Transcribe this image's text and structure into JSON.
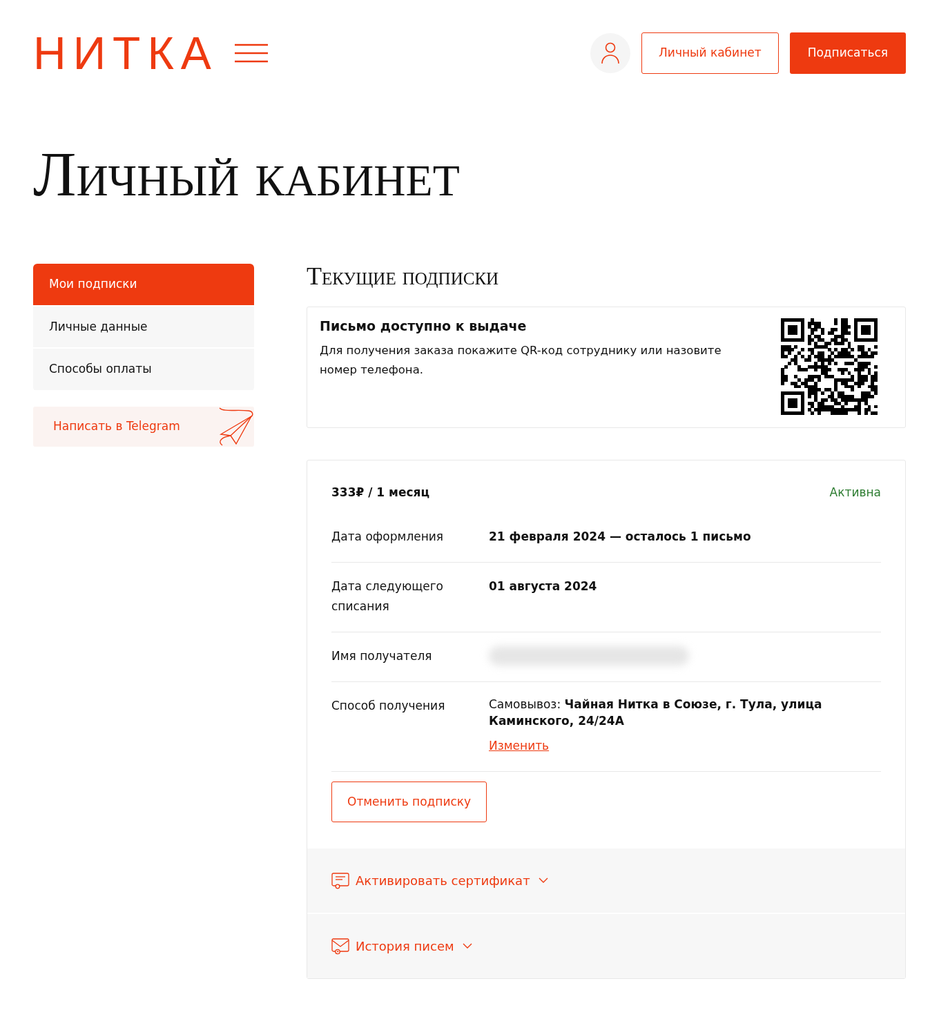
{
  "header": {
    "logo": "НИТКА",
    "cabinet_button": "Личный кабинет",
    "subscribe_button": "Подписаться"
  },
  "page_title": "Личный кабинет",
  "sidebar": {
    "items": [
      {
        "label": "Мои подписки",
        "selected": true
      },
      {
        "label": "Личные данные",
        "selected": false
      },
      {
        "label": "Способы оплаты",
        "selected": false
      }
    ],
    "telegram_button": "Написать в Telegram"
  },
  "section_title": "Текущие подписки",
  "pickup_notice": {
    "title": "Письмо доступно к выдаче",
    "text": "Для получения заказа покажите QR-код сотруднику или назовите номер телефона."
  },
  "subscription": {
    "plan": "333₽ / 1 месяц",
    "status": "Активна",
    "rows": [
      {
        "kind": "text",
        "label": "Дата оформления",
        "value": "21 февраля 2024 — осталось 1 письмо"
      },
      {
        "kind": "text",
        "label": "Дата следующего списания",
        "value": "01 августа 2024"
      },
      {
        "kind": "hidden",
        "label": "Имя получателя"
      },
      {
        "kind": "pickup",
        "label": "Способ получения",
        "value": "Самовывоз: **Чайная Нитка в Союзе, г. Тула, улица Каминского, 24/24А**",
        "link": "Изменить"
      }
    ],
    "cancel_button": "Отменить подписку",
    "sections": [
      {
        "kind": "certificate",
        "label": "Активировать сертификат",
        "expanded": false
      },
      {
        "kind": "history",
        "label": "История писем",
        "expanded": false
      }
    ]
  }
}
